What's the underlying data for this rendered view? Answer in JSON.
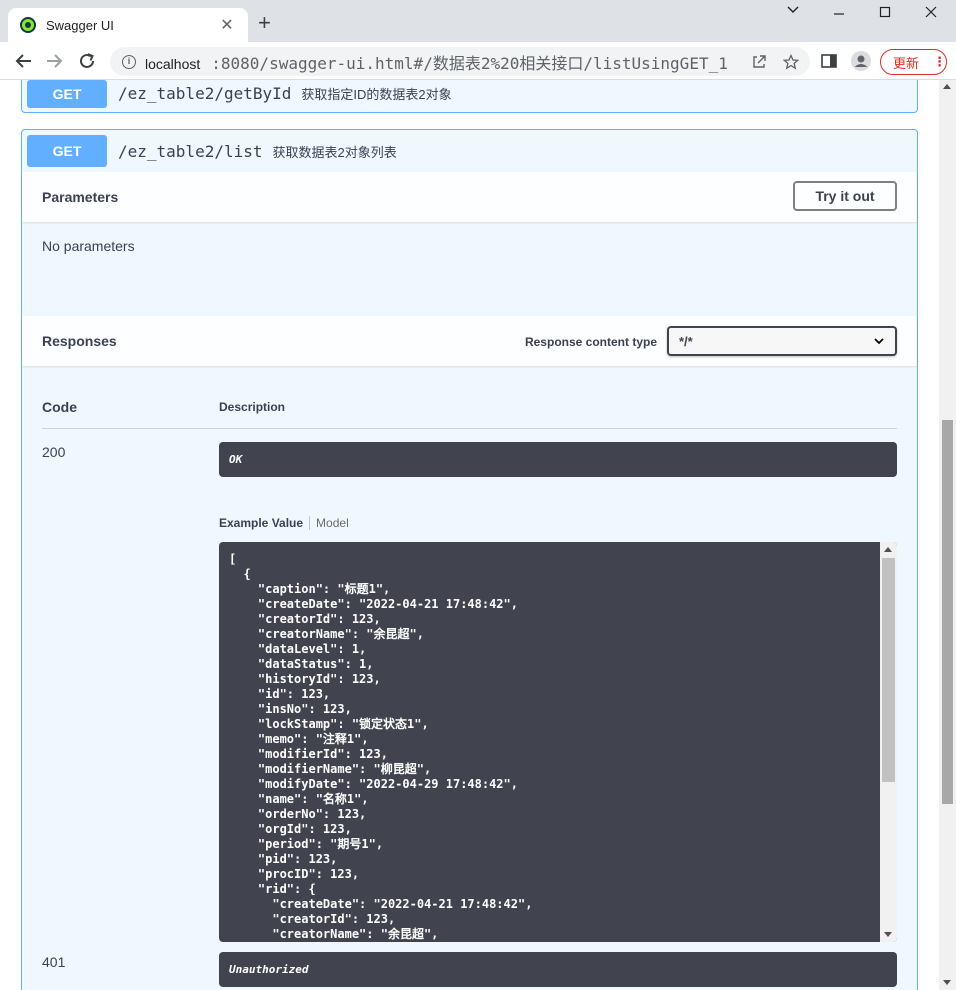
{
  "browser": {
    "tab_title": "Swagger UI",
    "url_host": "localhost",
    "url_rest": ":8080/swagger-ui.html#/数据表2%20相关接口/listUsingGET_1",
    "update_label": "更新"
  },
  "colors": {
    "get_method": "#61affe",
    "dark_panel": "#41444e",
    "update_red": "#d93025"
  },
  "ops": [
    {
      "method": "GET",
      "path": "/ez_table2/getById",
      "summary": "获取指定ID的数据表2对象"
    },
    {
      "method": "GET",
      "path": "/ez_table2/list",
      "summary": "获取数据表2对象列表"
    }
  ],
  "parameters": {
    "title": "Parameters",
    "try_label": "Try it out",
    "empty_text": "No parameters"
  },
  "responses": {
    "title": "Responses",
    "content_type_label": "Response content type",
    "content_type_value": "*/*",
    "col_code": "Code",
    "col_description": "Description",
    "rows": [
      {
        "code": "200",
        "description": "OK"
      },
      {
        "code": "401",
        "description": "Unauthorized"
      }
    ],
    "example_tab": "Example Value",
    "model_tab": "Model",
    "example_json": "[\n  {\n    \"caption\": \"标题1\",\n    \"createDate\": \"2022-04-21 17:48:42\",\n    \"creatorId\": 123,\n    \"creatorName\": \"余昆超\",\n    \"dataLevel\": 1,\n    \"dataStatus\": 1,\n    \"historyId\": 123,\n    \"id\": 123,\n    \"insNo\": 123,\n    \"lockStamp\": \"锁定状态1\",\n    \"memo\": \"注释1\",\n    \"modifierId\": 123,\n    \"modifierName\": \"柳昆超\",\n    \"modifyDate\": \"2022-04-29 17:48:42\",\n    \"name\": \"名称1\",\n    \"orderNo\": 123,\n    \"orgId\": 123,\n    \"period\": \"期号1\",\n    \"pid\": 123,\n    \"procID\": 123,\n    \"rid\": {\n      \"createDate\": \"2022-04-21 17:48:42\",\n      \"creatorId\": 123,\n      \"creatorName\": \"余昆超\","
  }
}
